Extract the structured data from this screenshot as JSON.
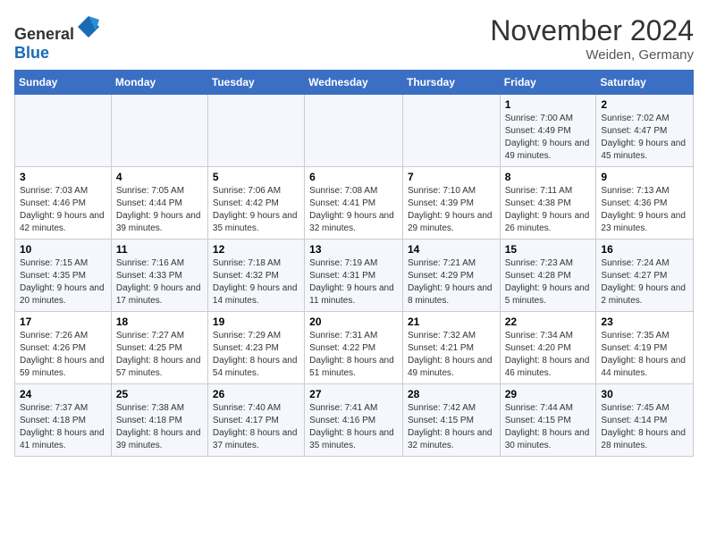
{
  "header": {
    "logo_general": "General",
    "logo_blue": "Blue",
    "month_title": "November 2024",
    "location": "Weiden, Germany"
  },
  "days_of_week": [
    "Sunday",
    "Monday",
    "Tuesday",
    "Wednesday",
    "Thursday",
    "Friday",
    "Saturday"
  ],
  "weeks": [
    [
      {
        "day": "",
        "detail": ""
      },
      {
        "day": "",
        "detail": ""
      },
      {
        "day": "",
        "detail": ""
      },
      {
        "day": "",
        "detail": ""
      },
      {
        "day": "",
        "detail": ""
      },
      {
        "day": "1",
        "detail": "Sunrise: 7:00 AM\nSunset: 4:49 PM\nDaylight: 9 hours and 49 minutes."
      },
      {
        "day": "2",
        "detail": "Sunrise: 7:02 AM\nSunset: 4:47 PM\nDaylight: 9 hours and 45 minutes."
      }
    ],
    [
      {
        "day": "3",
        "detail": "Sunrise: 7:03 AM\nSunset: 4:46 PM\nDaylight: 9 hours and 42 minutes."
      },
      {
        "day": "4",
        "detail": "Sunrise: 7:05 AM\nSunset: 4:44 PM\nDaylight: 9 hours and 39 minutes."
      },
      {
        "day": "5",
        "detail": "Sunrise: 7:06 AM\nSunset: 4:42 PM\nDaylight: 9 hours and 35 minutes."
      },
      {
        "day": "6",
        "detail": "Sunrise: 7:08 AM\nSunset: 4:41 PM\nDaylight: 9 hours and 32 minutes."
      },
      {
        "day": "7",
        "detail": "Sunrise: 7:10 AM\nSunset: 4:39 PM\nDaylight: 9 hours and 29 minutes."
      },
      {
        "day": "8",
        "detail": "Sunrise: 7:11 AM\nSunset: 4:38 PM\nDaylight: 9 hours and 26 minutes."
      },
      {
        "day": "9",
        "detail": "Sunrise: 7:13 AM\nSunset: 4:36 PM\nDaylight: 9 hours and 23 minutes."
      }
    ],
    [
      {
        "day": "10",
        "detail": "Sunrise: 7:15 AM\nSunset: 4:35 PM\nDaylight: 9 hours and 20 minutes."
      },
      {
        "day": "11",
        "detail": "Sunrise: 7:16 AM\nSunset: 4:33 PM\nDaylight: 9 hours and 17 minutes."
      },
      {
        "day": "12",
        "detail": "Sunrise: 7:18 AM\nSunset: 4:32 PM\nDaylight: 9 hours and 14 minutes."
      },
      {
        "day": "13",
        "detail": "Sunrise: 7:19 AM\nSunset: 4:31 PM\nDaylight: 9 hours and 11 minutes."
      },
      {
        "day": "14",
        "detail": "Sunrise: 7:21 AM\nSunset: 4:29 PM\nDaylight: 9 hours and 8 minutes."
      },
      {
        "day": "15",
        "detail": "Sunrise: 7:23 AM\nSunset: 4:28 PM\nDaylight: 9 hours and 5 minutes."
      },
      {
        "day": "16",
        "detail": "Sunrise: 7:24 AM\nSunset: 4:27 PM\nDaylight: 9 hours and 2 minutes."
      }
    ],
    [
      {
        "day": "17",
        "detail": "Sunrise: 7:26 AM\nSunset: 4:26 PM\nDaylight: 8 hours and 59 minutes."
      },
      {
        "day": "18",
        "detail": "Sunrise: 7:27 AM\nSunset: 4:25 PM\nDaylight: 8 hours and 57 minutes."
      },
      {
        "day": "19",
        "detail": "Sunrise: 7:29 AM\nSunset: 4:23 PM\nDaylight: 8 hours and 54 minutes."
      },
      {
        "day": "20",
        "detail": "Sunrise: 7:31 AM\nSunset: 4:22 PM\nDaylight: 8 hours and 51 minutes."
      },
      {
        "day": "21",
        "detail": "Sunrise: 7:32 AM\nSunset: 4:21 PM\nDaylight: 8 hours and 49 minutes."
      },
      {
        "day": "22",
        "detail": "Sunrise: 7:34 AM\nSunset: 4:20 PM\nDaylight: 8 hours and 46 minutes."
      },
      {
        "day": "23",
        "detail": "Sunrise: 7:35 AM\nSunset: 4:19 PM\nDaylight: 8 hours and 44 minutes."
      }
    ],
    [
      {
        "day": "24",
        "detail": "Sunrise: 7:37 AM\nSunset: 4:18 PM\nDaylight: 8 hours and 41 minutes."
      },
      {
        "day": "25",
        "detail": "Sunrise: 7:38 AM\nSunset: 4:18 PM\nDaylight: 8 hours and 39 minutes."
      },
      {
        "day": "26",
        "detail": "Sunrise: 7:40 AM\nSunset: 4:17 PM\nDaylight: 8 hours and 37 minutes."
      },
      {
        "day": "27",
        "detail": "Sunrise: 7:41 AM\nSunset: 4:16 PM\nDaylight: 8 hours and 35 minutes."
      },
      {
        "day": "28",
        "detail": "Sunrise: 7:42 AM\nSunset: 4:15 PM\nDaylight: 8 hours and 32 minutes."
      },
      {
        "day": "29",
        "detail": "Sunrise: 7:44 AM\nSunset: 4:15 PM\nDaylight: 8 hours and 30 minutes."
      },
      {
        "day": "30",
        "detail": "Sunrise: 7:45 AM\nSunset: 4:14 PM\nDaylight: 8 hours and 28 minutes."
      }
    ]
  ]
}
